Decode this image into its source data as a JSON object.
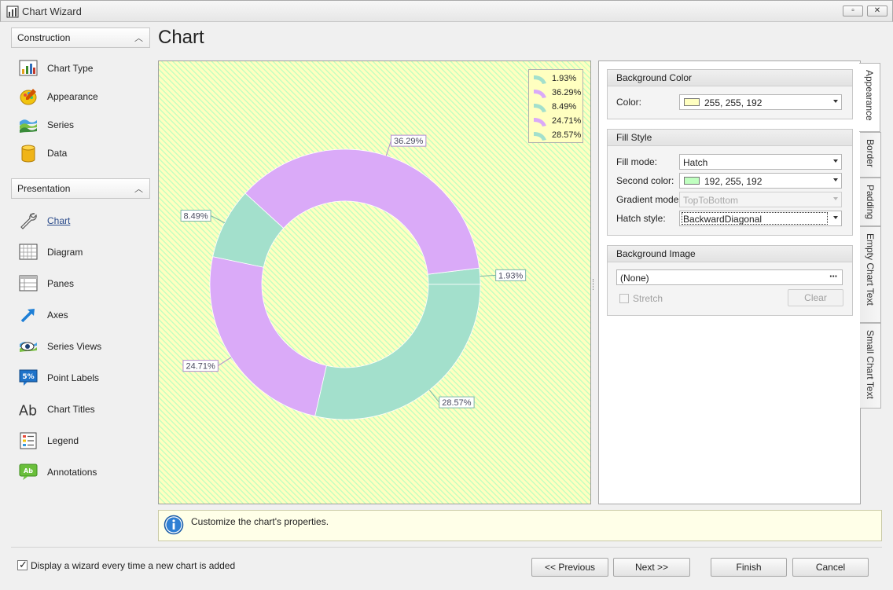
{
  "window": {
    "title": "Chart Wizard",
    "restore_glyph": "▫",
    "close_glyph": "✕"
  },
  "nav": {
    "construction": {
      "header": "Construction",
      "items": [
        {
          "label": "Chart Type",
          "icon": "chart-type-icon"
        },
        {
          "label": "Appearance",
          "icon": "appearance-icon"
        },
        {
          "label": "Series",
          "icon": "series-icon"
        },
        {
          "label": "Data",
          "icon": "data-icon"
        }
      ]
    },
    "presentation": {
      "header": "Presentation",
      "items": [
        {
          "label": "Chart",
          "icon": "wrench-icon",
          "active": true
        },
        {
          "label": "Diagram",
          "icon": "diagram-icon"
        },
        {
          "label": "Panes",
          "icon": "panes-icon"
        },
        {
          "label": "Axes",
          "icon": "axes-icon"
        },
        {
          "label": "Series Views",
          "icon": "series-views-icon"
        },
        {
          "label": "Point Labels",
          "icon": "point-labels-icon",
          "icon_text": "5%"
        },
        {
          "label": "Chart Titles",
          "icon": "chart-titles-icon",
          "icon_text": "Ab"
        },
        {
          "label": "Legend",
          "icon": "legend-icon"
        },
        {
          "label": "Annotations",
          "icon": "annotations-icon",
          "icon_text": "Ab"
        }
      ]
    }
  },
  "page_title": "Chart",
  "chart_data": {
    "type": "pie",
    "variant": "doughnut",
    "background": {
      "color": "#ffffc0",
      "hatch_color": "#c0ffc0",
      "hatch_style": "BackwardDiagonal"
    },
    "slices": [
      {
        "label": "1.93%",
        "value": 1.93,
        "color": "#a3e0cc"
      },
      {
        "label": "36.29%",
        "value": 36.29,
        "color": "#daaaf8"
      },
      {
        "label": "8.49%",
        "value": 8.49,
        "color": "#a3e0cc"
      },
      {
        "label": "24.71%",
        "value": 24.71,
        "color": "#daaaf8"
      },
      {
        "label": "28.57%",
        "value": 28.57,
        "color": "#a3e0cc"
      }
    ],
    "legend": {
      "position": "top-right"
    },
    "label_border_colors": [
      "#7fb5a8",
      "#b38ed0"
    ]
  },
  "panel": {
    "background_color": {
      "header": "Background Color",
      "color_label": "Color:",
      "color_value": "255, 255, 192",
      "swatch": "#ffffc0"
    },
    "fill_style": {
      "header": "Fill Style",
      "fill_mode_label": "Fill mode:",
      "fill_mode_value": "Hatch",
      "second_color_label": "Second color:",
      "second_color_value": "192, 255, 192",
      "second_swatch": "#c0ffc0",
      "gradient_mode_label": "Gradient mode",
      "gradient_mode_value": "TopToBottom",
      "hatch_style_label": "Hatch style:",
      "hatch_style_value": "BackwardDiagonal"
    },
    "background_image": {
      "header": "Background Image",
      "value": "(None)",
      "ellipsis": "···",
      "stretch_label": "Stretch",
      "clear_label": "Clear"
    }
  },
  "tabs": [
    "Appearance",
    "Border",
    "Padding",
    "Empty Chart Text",
    "Small Chart Text"
  ],
  "info": {
    "message": "Customize the chart's properties."
  },
  "footer": {
    "checkbox_label": "Display a wizard every time a new chart is added",
    "checkbox_checked": true,
    "check_glyph": "✓",
    "previous": "<< Previous",
    "next": "Next >>",
    "finish": "Finish",
    "cancel": "Cancel"
  }
}
